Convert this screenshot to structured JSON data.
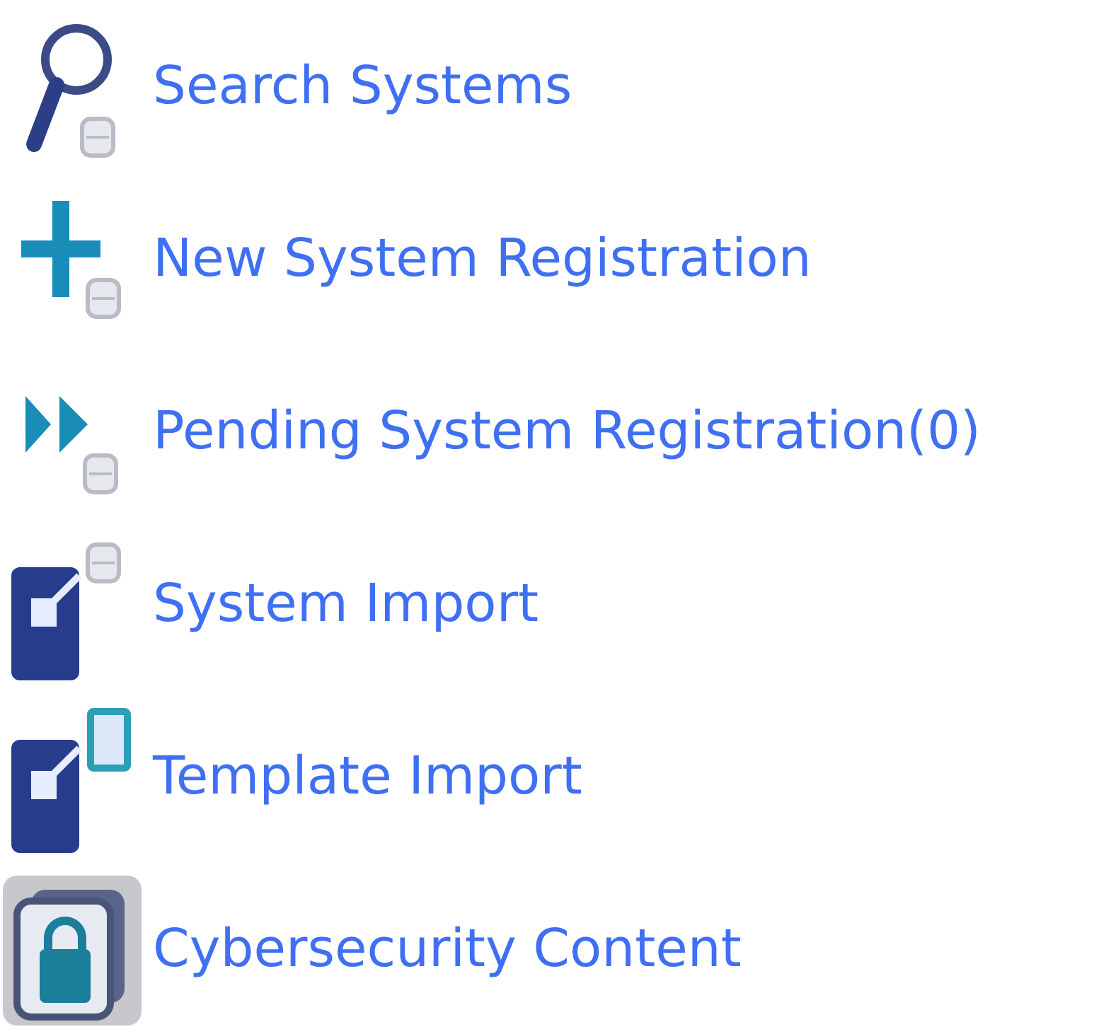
{
  "menu": {
    "items": [
      {
        "kind": "search",
        "label": "Search Systems"
      },
      {
        "kind": "new",
        "label": "New System Registration"
      },
      {
        "kind": "pending",
        "label": "Pending System Registration(0)"
      },
      {
        "kind": "system-import",
        "label": "System Import"
      },
      {
        "kind": "template-import",
        "label": "Template Import"
      },
      {
        "kind": "content",
        "label": "Cybersecurity Content"
      }
    ]
  }
}
